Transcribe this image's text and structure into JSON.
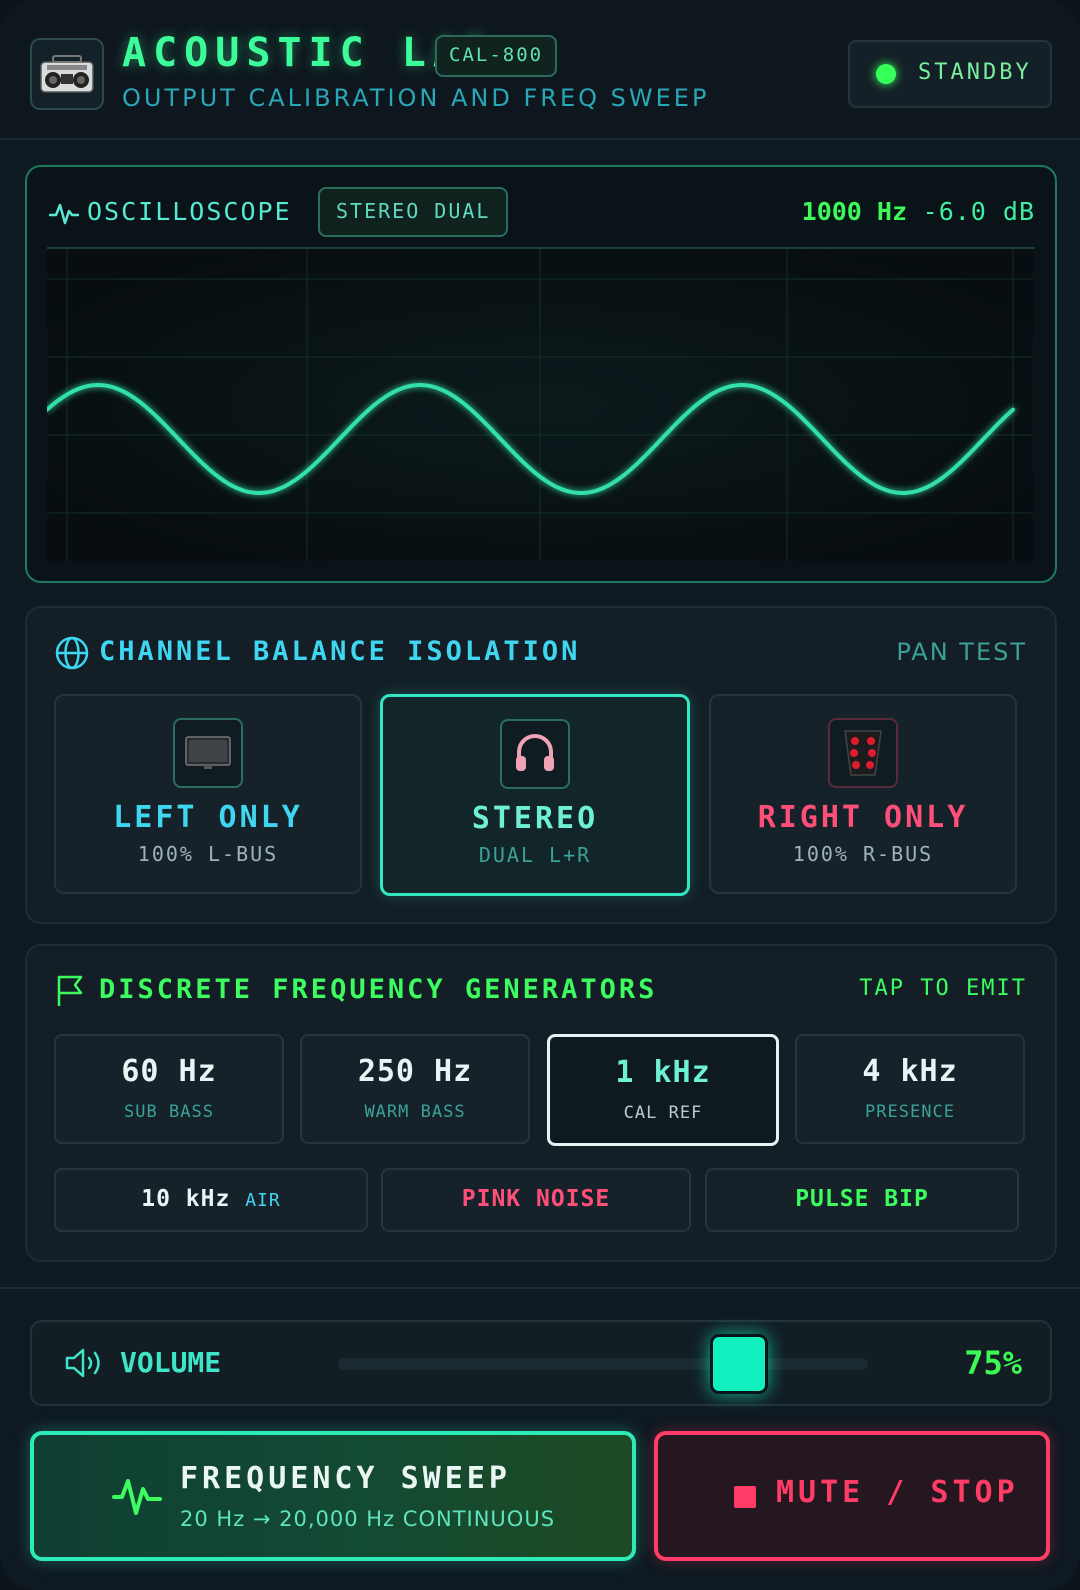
{
  "header": {
    "title": "ACOUSTIC LAB",
    "model": "CAL-800",
    "subtitle": "OUTPUT CALIBRATION AND FREQ SWEEP",
    "status": "STANDBY",
    "logo_icon": "boombox-icon"
  },
  "scope": {
    "label": "OSCILLOSCOPE",
    "mode": "STEREO DUAL",
    "frequency": "1000 Hz",
    "level": "-6.0 dB",
    "trace_color": "#33e0a8",
    "visible_cycles": 3
  },
  "balance": {
    "title": "CHANNEL BALANCE ISOLATION",
    "aside": "PAN TEST",
    "channels": [
      {
        "label": "LEFT ONLY",
        "sub": "100% L-BUS",
        "icon": "monitor-icon",
        "color": "#3fd6f2"
      },
      {
        "label": "STEREO",
        "sub": "DUAL L+R",
        "icon": "headphones-icon",
        "color": "#6ef0d2"
      },
      {
        "label": "RIGHT ONLY",
        "sub": "100% R-BUS",
        "icon": "speaker-icon",
        "color": "#ff4f78"
      }
    ],
    "active": "STEREO"
  },
  "generators": {
    "title": "DISCRETE FREQUENCY GENERATORS",
    "aside": "TAP TO EMIT",
    "tones": [
      {
        "value": "60 Hz",
        "desc": "SUB BASS"
      },
      {
        "value": "250 Hz",
        "desc": "WARM BASS"
      },
      {
        "value": "1 kHz",
        "desc": "CAL REF"
      },
      {
        "value": "4 kHz",
        "desc": "PRESENCE"
      }
    ],
    "active_tone": "1 kHz",
    "extra": {
      "air_value": "10 kHz",
      "air_desc": "AIR",
      "pink_noise": "PINK NOISE",
      "pulse_bip": "PULSE BIP"
    }
  },
  "volume": {
    "label": "VOLUME",
    "value_text": "75%",
    "level": 0.75
  },
  "actions": {
    "sweep_title": "FREQUENCY SWEEP",
    "sweep_sub": "20 Hz → 20,000 Hz CONTINUOUS",
    "stop_label": "MUTE / STOP"
  },
  "colors": {
    "accent_green": "#3dfc9a",
    "accent_cyan": "#3fd6f2",
    "accent_red": "#ff3c66",
    "teal": "#2deab6"
  }
}
